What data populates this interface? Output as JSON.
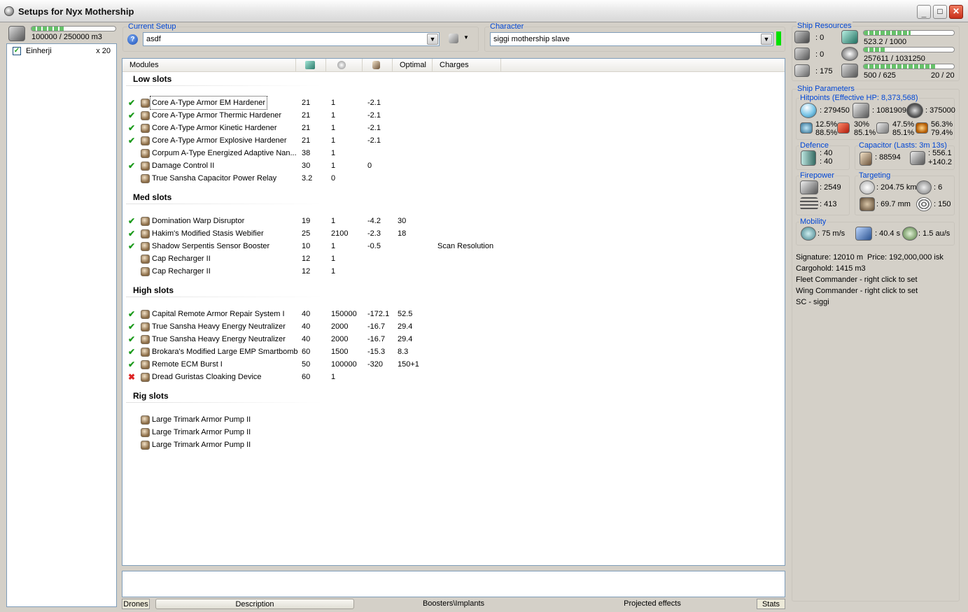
{
  "window": {
    "title": "Setups for Nyx Mothership"
  },
  "drones": {
    "capacity": "100000 / 250000 m3",
    "bay_fill": 0.4,
    "items": [
      {
        "name": "Einherji",
        "count": "x 20",
        "checked": true
      }
    ]
  },
  "setup": {
    "group_label": "Current Setup",
    "value": "asdf"
  },
  "character": {
    "group_label": "Character",
    "value": "siggi mothership slave",
    "status_color": "#00e000"
  },
  "modules": {
    "headers": [
      "Modules",
      "",
      "",
      "",
      "Optimal",
      "Charges"
    ],
    "header_icons": [
      "cpu-icon",
      "powergrid-icon",
      "capacitor-icon"
    ],
    "sections": [
      {
        "title": "Low slots",
        "rows": [
          {
            "status": "ok",
            "name": "Core A-Type Armor EM Hardener",
            "cpu": "21",
            "pg": "1",
            "cap": "-2.1",
            "optimal": "",
            "charge": ""
          },
          {
            "status": "ok",
            "name": "Core A-Type Armor Thermic Hardener",
            "cpu": "21",
            "pg": "1",
            "cap": "-2.1",
            "optimal": "",
            "charge": ""
          },
          {
            "status": "ok",
            "name": "Core A-Type Armor Kinetic Hardener",
            "cpu": "21",
            "pg": "1",
            "cap": "-2.1",
            "optimal": "",
            "charge": ""
          },
          {
            "status": "ok",
            "name": "Core A-Type Armor Explosive Hardener",
            "cpu": "21",
            "pg": "1",
            "cap": "-2.1",
            "optimal": "",
            "charge": ""
          },
          {
            "status": "none",
            "name": "Corpum A-Type Energized Adaptive Nan...",
            "cpu": "38",
            "pg": "1",
            "cap": "",
            "optimal": "",
            "charge": ""
          },
          {
            "status": "ok",
            "name": "Damage Control II",
            "cpu": "30",
            "pg": "1",
            "cap": "0",
            "optimal": "",
            "charge": ""
          },
          {
            "status": "none",
            "name": "True Sansha Capacitor Power Relay",
            "cpu": "3.2",
            "pg": "0",
            "cap": "",
            "optimal": "",
            "charge": ""
          }
        ]
      },
      {
        "title": "Med slots",
        "rows": [
          {
            "status": "ok",
            "name": "Domination Warp Disruptor",
            "cpu": "19",
            "pg": "1",
            "cap": "-4.2",
            "optimal": "30",
            "charge": ""
          },
          {
            "status": "ok",
            "name": "Hakim's Modified Stasis Webifier",
            "cpu": "25",
            "pg": "2100",
            "cap": "-2.3",
            "optimal": "18",
            "charge": ""
          },
          {
            "status": "ok",
            "name": "Shadow Serpentis Sensor Booster",
            "cpu": "10",
            "pg": "1",
            "cap": "-0.5",
            "optimal": "",
            "charge": "Scan Resolution"
          },
          {
            "status": "none",
            "name": "Cap Recharger II",
            "cpu": "12",
            "pg": "1",
            "cap": "",
            "optimal": "",
            "charge": ""
          },
          {
            "status": "none",
            "name": "Cap Recharger II",
            "cpu": "12",
            "pg": "1",
            "cap": "",
            "optimal": "",
            "charge": ""
          }
        ]
      },
      {
        "title": "High slots",
        "rows": [
          {
            "status": "ok",
            "name": "Capital Remote Armor Repair System I",
            "cpu": "40",
            "pg": "150000",
            "cap": "-172.1",
            "optimal": "52.5",
            "charge": ""
          },
          {
            "status": "ok",
            "name": "True Sansha Heavy Energy Neutralizer",
            "cpu": "40",
            "pg": "2000",
            "cap": "-16.7",
            "optimal": "29.4",
            "charge": ""
          },
          {
            "status": "ok",
            "name": "True Sansha Heavy Energy Neutralizer",
            "cpu": "40",
            "pg": "2000",
            "cap": "-16.7",
            "optimal": "29.4",
            "charge": ""
          },
          {
            "status": "ok",
            "name": "Brokara's Modified Large EMP Smartbomb",
            "cpu": "60",
            "pg": "1500",
            "cap": "-15.3",
            "optimal": "8.3",
            "charge": ""
          },
          {
            "status": "ok",
            "name": "Remote ECM Burst I",
            "cpu": "50",
            "pg": "100000",
            "cap": "-320",
            "optimal": "150+1",
            "charge": ""
          },
          {
            "status": "error",
            "name": "Dread Guristas Cloaking Device",
            "cpu": "60",
            "pg": "1",
            "cap": "",
            "optimal": "",
            "charge": ""
          }
        ]
      },
      {
        "title": "Rig slots",
        "rows": [
          {
            "status": "none",
            "name": "Large Trimark Armor Pump II",
            "cpu": "",
            "pg": "",
            "cap": "",
            "optimal": "",
            "charge": ""
          },
          {
            "status": "none",
            "name": "Large Trimark Armor Pump II",
            "cpu": "",
            "pg": "",
            "cap": "",
            "optimal": "",
            "charge": ""
          },
          {
            "status": "none",
            "name": "Large Trimark Armor Pump II",
            "cpu": "",
            "pg": "",
            "cap": "",
            "optimal": "",
            "charge": ""
          }
        ]
      }
    ]
  },
  "resources": {
    "title": "Ship Resources",
    "turret_hardpoints": ": 0",
    "launcher_hardpoints": ": 0",
    "calibration": ": 175",
    "cpu": "523.2 / 1000",
    "cpu_fill": 0.523,
    "powergrid": "257611 / 1031250",
    "powergrid_fill": 0.25,
    "drone_bandwidth": "500 / 625",
    "drone_bandwidth_fill": 0.8,
    "drones_active": "20 / 20"
  },
  "parameters": {
    "title": "Ship Parameters",
    "hitpoints_title": "Hitpoints (Effective HP: 8,373,568)",
    "shield_hp": ": 279450",
    "armor_hp": ": 1081909",
    "structure_hp": ": 375000",
    "resist_em_a": "12.5%",
    "resist_em_b": "88.5%",
    "resist_th_a": "30%",
    "resist_th_b": "85.1%",
    "resist_ki_a": "47.5%",
    "resist_ki_b": "85.1%",
    "resist_ex_a": "56.3%",
    "resist_ex_b": "79.4%",
    "defence_title": "Defence",
    "defence_a": ": 40",
    "defence_b": ": 40",
    "capacitor_title": "Capacitor (Lasts: 3m 13s)",
    "capacitor_amount": ": 88594",
    "cap_a": ": 556.1",
    "cap_b": "+140.2",
    "firepower_title": "Firepower",
    "dps": ": 2549",
    "volley": ": 413",
    "targeting_title": "Targeting",
    "range": ": 204.75 km",
    "max_targets": ": 6",
    "sig_res": ": 69.7 mm",
    "scan_res": ": 150",
    "mobility_title": "Mobility",
    "speed": ": 75 m/s",
    "align": ": 40.4 s",
    "warp": ": 1.5 au/s"
  },
  "info": {
    "signature": "Signature: 12010 m",
    "price": "Price: 192,000,000 isk",
    "cargohold": "Cargohold: 1415 m3",
    "fleet_commander": "Fleet Commander - right click to set",
    "wing_commander": "Wing Commander - right click to set",
    "squad_commander": "SC - siggi"
  },
  "tabs": {
    "drones": "Drones",
    "description": "Description",
    "boosters": "Boosters\\Implants",
    "projected": "Projected effects",
    "stats": "Stats"
  }
}
